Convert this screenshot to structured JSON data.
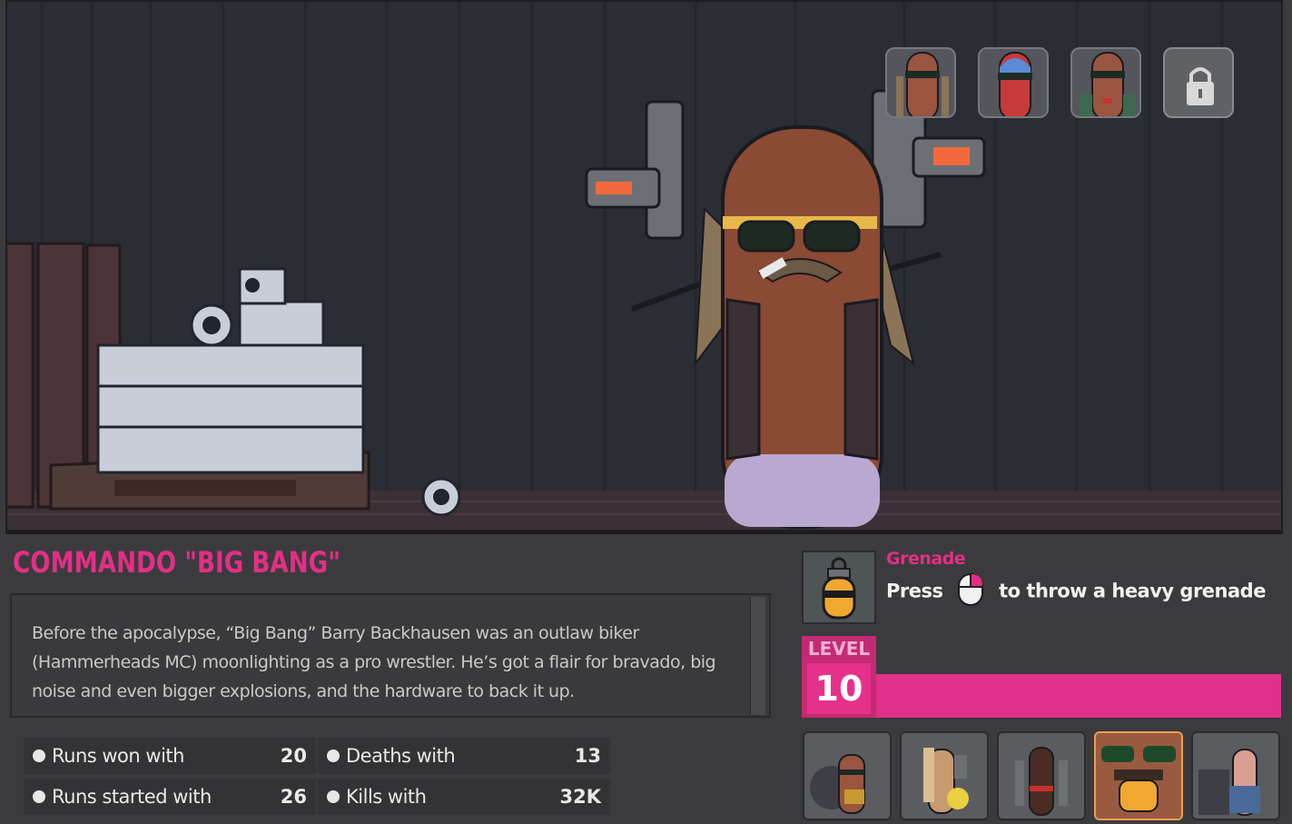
{
  "character": {
    "name": "COMMANDO \"BIG BANG\"",
    "description": "Before the apocalypse, “Big Bang” Barry Backhausen was an outlaw biker (Hammerheads MC) moonlighting as a pro wrestler. He’s got a flair for bravado, big noise and even bigger explosions, and the hardware to back it up."
  },
  "stats": [
    {
      "label": "Runs won with",
      "value": "20"
    },
    {
      "label": "Deaths with",
      "value": "13"
    },
    {
      "label": "Runs started with",
      "value": "26"
    },
    {
      "label": "Kills with",
      "value": "32K"
    }
  ],
  "ability": {
    "name": "Grenade",
    "prefix": "Press",
    "suffix": "to throw a heavy grenade",
    "icon": "grenade-icon",
    "input_icon": "mouse-right-click-icon"
  },
  "level": {
    "label": "LEVEL",
    "value": "10",
    "progress": 1.0
  },
  "skins": [
    {
      "name": "skin-biker",
      "locked": false
    },
    {
      "name": "skin-masked-wrestler",
      "locked": false
    },
    {
      "name": "skin-suit",
      "locked": false
    },
    {
      "name": "skin-locked",
      "locked": true,
      "icon": "padlock-icon"
    }
  ],
  "characters": [
    {
      "name": "character-1"
    },
    {
      "name": "character-2"
    },
    {
      "name": "character-3"
    },
    {
      "name": "character-4"
    },
    {
      "name": "character-5"
    }
  ],
  "colors": {
    "accent": "#e32f86",
    "background": "#3b3b3d",
    "scene": "#2b2d35"
  }
}
